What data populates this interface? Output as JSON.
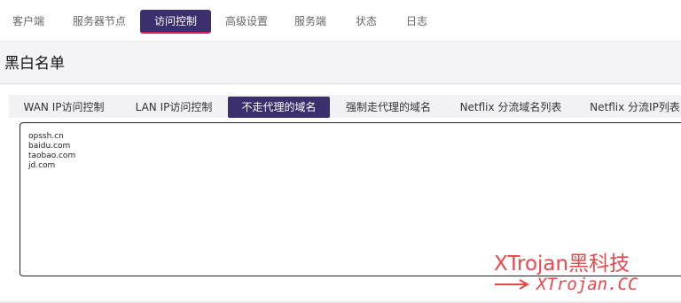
{
  "topnav": {
    "items": [
      {
        "label": "客户端"
      },
      {
        "label": "服务器节点"
      },
      {
        "label": "访问控制"
      },
      {
        "label": "高级设置"
      },
      {
        "label": "服务端"
      },
      {
        "label": "状态"
      },
      {
        "label": "日志"
      }
    ],
    "active": "访问控制"
  },
  "section": {
    "title": "黑白名单"
  },
  "tabs": [
    {
      "label": "WAN IP访问控制"
    },
    {
      "label": "LAN IP访问控制"
    },
    {
      "label": "不走代理的域名"
    },
    {
      "label": "强制走代理的域名"
    },
    {
      "label": "Netflix 分流域名列表"
    },
    {
      "label": "Netflix 分流IP列表"
    }
  ],
  "active_tab": "不走代理的域名",
  "domain_list": {
    "lines": [
      "opssh.cn",
      "baidu.com",
      "taobao.com",
      "jd.com"
    ]
  },
  "watermark": {
    "brand": "XTrojan黑科技",
    "link": "XTrojan.CC",
    "color": "#e8333a"
  },
  "colors": {
    "accent": "#3b2f6e",
    "accent_underline": "#e0195a"
  }
}
